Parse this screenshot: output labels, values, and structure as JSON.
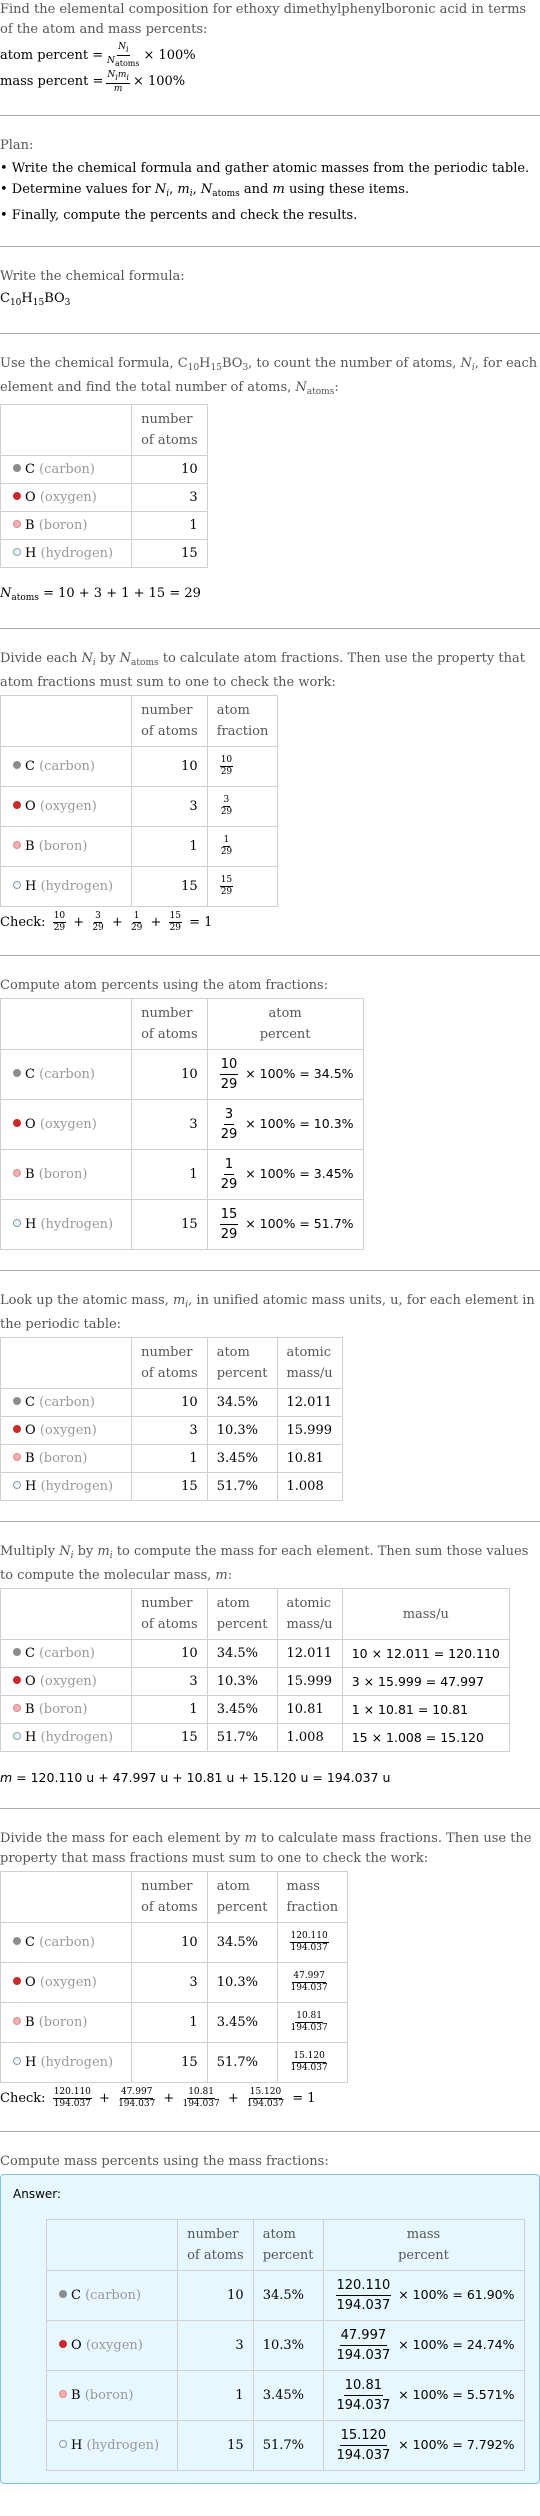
{
  "question": {
    "text": "Find the elemental composition for ethoxy dimethylphenylboronic acid in terms of the atom and mass percents:",
    "atom_percent_label": "atom percent =",
    "atom_percent_num": "N",
    "atom_percent_num_sub": "i",
    "atom_percent_den": "N",
    "atom_percent_den_sub": "atoms",
    "times_100": "× 100%",
    "mass_percent_label": "mass percent =",
    "mass_percent_num": "N",
    "mass_percent_num_sub": "i",
    "mass_percent_num2": "m",
    "mass_percent_num2_sub": "i",
    "mass_percent_den": "m"
  },
  "plan": {
    "title": "Plan:",
    "items": [
      "• Write the chemical formula and gather atomic masses from the periodic table.",
      "• Determine values for N_i, m_i, N_atoms and m using these items.",
      "• Finally, compute the percents and check the results."
    ],
    "item2_prefix": "• Determine values for ",
    "item2_suffix": " using these items."
  },
  "formula_step": {
    "intro": "Write the chemical formula:",
    "formula_parts": [
      {
        "el": "C",
        "n": "10"
      },
      {
        "el": "H",
        "n": "15"
      },
      {
        "el": "B",
        "n": ""
      },
      {
        "el": "O",
        "n": "3"
      }
    ]
  },
  "elements": [
    {
      "symbol": "C",
      "name": "(carbon)",
      "color": "#8c8c8c",
      "border": "#8c8c8c",
      "atoms": "10",
      "fraction_num": "10",
      "fraction_den": "29",
      "atom_percent": "34.5%",
      "atomic_mass": "12.011",
      "mass_expr": "10 × 12.011 = 120.110",
      "mass": "120.110",
      "mass_percent": "61.90%"
    },
    {
      "symbol": "O",
      "name": "(oxygen)",
      "color": "#cc2a2a",
      "border": "#cc2a2a",
      "atoms": "3",
      "fraction_num": "3",
      "fraction_den": "29",
      "atom_percent": "10.3%",
      "atomic_mass": "15.999",
      "mass_expr": "3 × 15.999 = 47.997",
      "mass": "47.997",
      "mass_percent": "24.74%"
    },
    {
      "symbol": "B",
      "name": "(boron)",
      "color": "#f4b0b0",
      "border": "#e08a8a",
      "atoms": "1",
      "fraction_num": "1",
      "fraction_den": "29",
      "atom_percent": "3.45%",
      "atomic_mass": "10.81",
      "mass_expr": "1 × 10.81 = 10.81",
      "mass": "10.81",
      "mass_percent": "5.571%"
    },
    {
      "symbol": "H",
      "name": "(hydrogen)",
      "color": "#eaf8fb",
      "border": "#8a9aa0",
      "atoms": "15",
      "fraction_num": "15",
      "fraction_den": "29",
      "atom_percent": "51.7%",
      "atomic_mass": "1.008",
      "mass_expr": "15 × 1.008 = 15.120",
      "mass": "15.120",
      "mass_percent": "7.792%"
    }
  ],
  "headers": {
    "number_of_atoms": [
      "number",
      "of atoms"
    ],
    "atom_fraction": [
      "atom",
      "fraction"
    ],
    "atom_percent": [
      "atom",
      "percent"
    ],
    "atomic_mass": [
      "atomic",
      "mass/u"
    ],
    "mass": "mass/u",
    "mass_fraction": [
      "mass",
      "fraction"
    ],
    "mass_percent": [
      "mass",
      "percent"
    ]
  },
  "count_step": {
    "intro_a": "Use the chemical formula, ",
    "intro_b": ", to count the number of atoms, ",
    "intro_c": ", for each element and find the total number of atoms, ",
    "intro_d": ":",
    "total_expr": "= 10 + 3 + 1 + 15 = 29"
  },
  "fraction_step": {
    "intro_a": "Divide each ",
    "intro_b": " by ",
    "intro_c": " to calculate atom fractions. Then use the property that atom fractions must sum to one to check the work:",
    "check_label": "Check:",
    "check_result": "= 1"
  },
  "atom_percent_step": {
    "intro": "Compute atom percents using the atom fractions:",
    "times": "× 100% ="
  },
  "mass_lookup_step": {
    "intro_a": "Look up the atomic mass, ",
    "intro_b": ", in unified atomic mass units, u, for each element in the periodic table:"
  },
  "mass_step": {
    "intro_a": "Multiply ",
    "intro_b": " by ",
    "intro_c": " to compute the mass for each element. Then sum those values to compute the molecular mass, ",
    "intro_d": ":",
    "total_expr": "= 120.110 u + 47.997 u + 10.81 u + 15.120 u = 194.037 u",
    "molecular_mass": "194.037"
  },
  "mass_fraction_step": {
    "intro_a": "Divide the mass for each element by ",
    "intro_b": " to calculate mass fractions. Then use the property that mass fractions must sum to one to check the work:",
    "check_label": "Check:",
    "check_result": "= 1"
  },
  "mass_percent_step": {
    "intro": "Compute mass percents using the mass fractions:",
    "answer_label": "Answer:",
    "times": "× 100% ="
  },
  "symbols": {
    "N": "N",
    "m": "m",
    "i": "i",
    "atoms": "atoms",
    "plus": "+",
    "comma": ", ",
    "and": " and "
  }
}
